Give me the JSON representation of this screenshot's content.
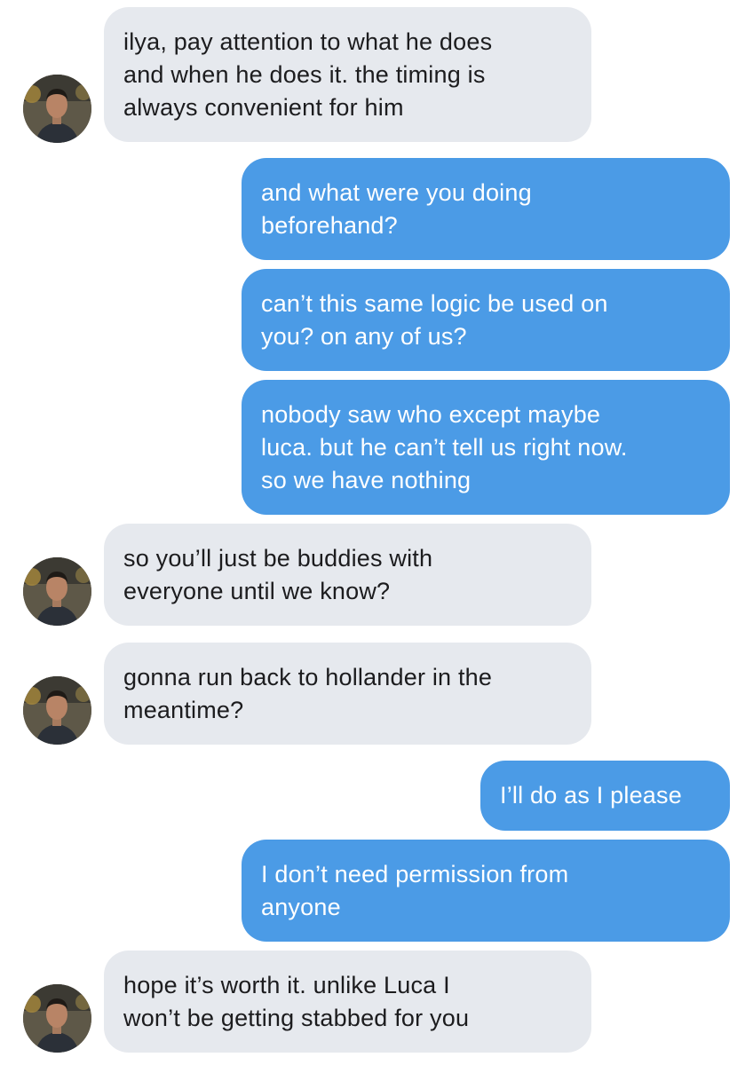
{
  "colors": {
    "incoming_bubble": "#e6e9ee",
    "outgoing_bubble": "#4b9be6",
    "incoming_text": "#1c1c1e",
    "outgoing_text": "#ffffff"
  },
  "messages": [
    {
      "direction": "incoming",
      "lines": [
        "ilya, pay attention to what he does",
        "and when he does it. the timing is",
        "always convenient for him"
      ]
    },
    {
      "direction": "outgoing",
      "lines": [
        "and what were you doing",
        "beforehand?"
      ]
    },
    {
      "direction": "outgoing",
      "lines": [
        "can’t this same logic be used on",
        "you? on any of us?"
      ]
    },
    {
      "direction": "outgoing",
      "lines": [
        "nobody saw who except maybe",
        "luca. but he can’t tell us right now.",
        "so we have nothing"
      ]
    },
    {
      "direction": "incoming",
      "lines": [
        "so you’ll just be buddies with",
        "everyone until we know?"
      ]
    },
    {
      "direction": "incoming",
      "lines": [
        "gonna run back to hollander in the",
        "meantime?"
      ]
    },
    {
      "direction": "outgoing",
      "lines": [
        "I’ll do as I please"
      ]
    },
    {
      "direction": "outgoing",
      "lines": [
        "I don’t need permission from",
        "anyone"
      ]
    },
    {
      "direction": "incoming",
      "lines": [
        "hope it’s worth it. unlike Luca I",
        "won’t be getting stabbed for you"
      ]
    }
  ]
}
